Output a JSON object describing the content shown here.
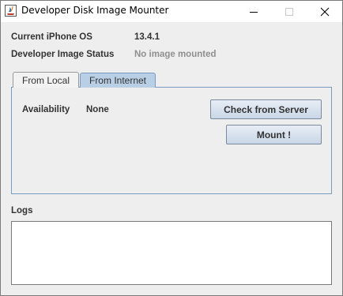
{
  "window": {
    "title": "Developer Disk Image Mounter",
    "icon": "java-app-icon"
  },
  "info": {
    "ios_label": "Current iPhone OS",
    "ios_value": "13.4.1",
    "status_label": "Developer Image Status",
    "status_value": "No image mounted"
  },
  "tabs": [
    {
      "label": "From Local",
      "selected": false
    },
    {
      "label": "From Internet",
      "selected": true
    }
  ],
  "panel": {
    "availability_label": "Availability",
    "availability_value": "None",
    "check_button": "Check from Server",
    "mount_button": "Mount !"
  },
  "logs": {
    "label": "Logs",
    "content": ""
  },
  "colors": {
    "selected_tab": "#b8cfe5",
    "button": "#d4e0ee",
    "background": "#eeeeee"
  }
}
